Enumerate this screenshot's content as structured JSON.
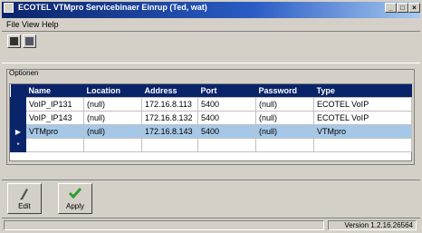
{
  "window": {
    "title": "ECOTEL VTMpro Servicebinaer Einrup (Ted, wat)",
    "min_label": "_",
    "max_label": "□",
    "close_label": "×"
  },
  "menu": {
    "items": [
      "File",
      "View",
      "Help"
    ]
  },
  "toolbar": {
    "buttons": [
      "save-icon",
      "list-icon"
    ]
  },
  "group": {
    "label": "Optionen"
  },
  "table": {
    "columns": [
      "Name",
      "Location",
      "Address",
      "Port",
      "Password",
      "Type"
    ],
    "rows": [
      {
        "name": "VoIP_IP131",
        "location": "(null)",
        "address": "172.16.8.113",
        "port": "5400",
        "password": "(null)",
        "type": "ECOTEL VoIP",
        "indicator": ""
      },
      {
        "name": "VoIP_IP143",
        "location": "(null)",
        "address": "172.16.8.132",
        "port": "5400",
        "password": "(null)",
        "type": "ECOTEL VoIP",
        "indicator": ""
      },
      {
        "name": "VTMpro",
        "location": "(null)",
        "address": "172.16.8.143",
        "port": "5400",
        "password": "(null)",
        "type": "VTMpro",
        "indicator": "▶"
      },
      {
        "name": "",
        "location": "",
        "address": "",
        "port": "",
        "password": "",
        "type": "",
        "indicator": "*"
      }
    ]
  },
  "actions": {
    "edit_label": "Edit",
    "apply_label": "Apply"
  },
  "status": {
    "version": "Version 1.2.16.26564"
  },
  "colors": {
    "title_bar": "#0a246a",
    "selected_row": "#a6c8e8",
    "window_bg": "#d4d0c8",
    "apply_check": "#2e9e2e"
  }
}
